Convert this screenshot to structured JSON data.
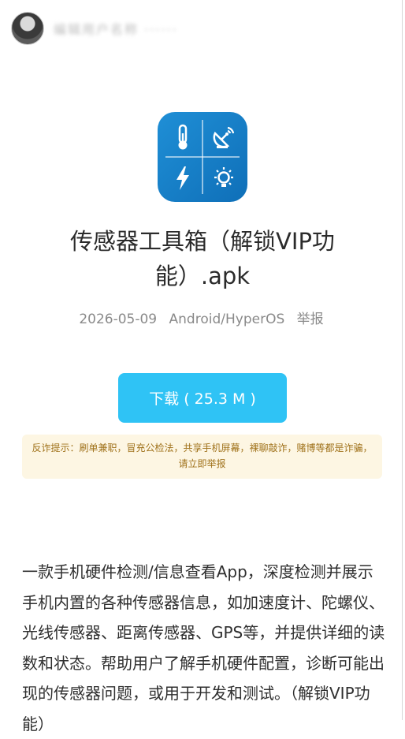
{
  "user": {
    "name": "编辑用户名称 ······"
  },
  "app": {
    "title_line1": "传感器工具箱（解锁VIP功",
    "title_line2": "能）.apk",
    "date": "2026-05-09",
    "platform": "Android/HyperOS",
    "report_label": "举报",
    "icon_name": "sensor-toolbox-app-icon"
  },
  "download": {
    "label": "下载 ( 25.3 M )"
  },
  "notice": {
    "text": "反诈提示：刷单兼职，冒充公检法，共享手机屏幕，裸聊敲诈，赌博等都是诈骗，请立即举报"
  },
  "description": {
    "text": "一款手机硬件检测/信息查看App，深度检测并展示手机内置的各种传感器信息，如加速度计、陀螺仪、光线传感器、距离传感器、GPS等，并提供详细的读数和状态。帮助用户了解手机硬件配置，诊断可能出现的传感器问题，或用于开发和测试。（解锁VIP功能）"
  },
  "colors": {
    "download": "#2fc3f5",
    "notice_bg": "#fdf6e3",
    "notice_text": "#a0721b",
    "icon_bg": "#1a84cc"
  }
}
